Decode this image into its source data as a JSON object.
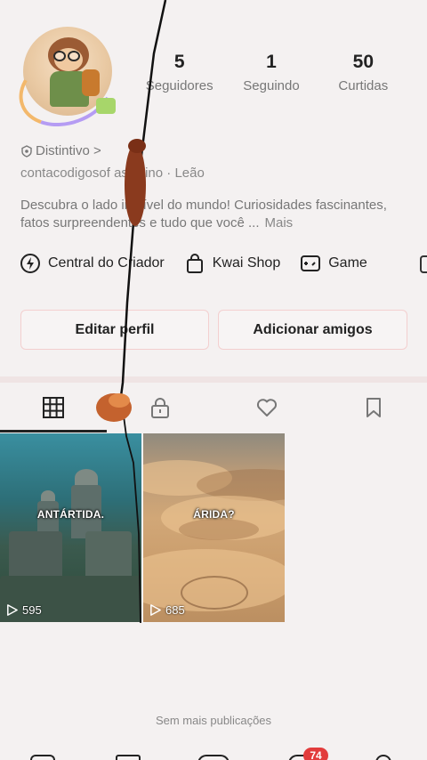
{
  "profile": {
    "stats": [
      {
        "value": "5",
        "label": "Seguidores"
      },
      {
        "value": "1",
        "label": "Seguindo"
      },
      {
        "value": "50",
        "label": "Curtidas"
      }
    ],
    "badge": "Distintivo >",
    "info_line": "contacodigosof      asculino · Leão",
    "bio": "Descubra o lado incrível do mundo! Curiosidades fascinantes, fatos surpreendentes e tudo que você ...",
    "bio_more": "Mais"
  },
  "tools": [
    {
      "label": "Central do Criador",
      "icon": "lightning-icon"
    },
    {
      "label": "Kwai Shop",
      "icon": "shopping-bag-icon"
    },
    {
      "label": "Game",
      "icon": "gamepad-icon"
    }
  ],
  "buttons": {
    "edit": "Editar perfil",
    "add": "Adicionar amigos"
  },
  "tabs": [
    {
      "name": "grid",
      "icon": "grid-icon",
      "active": true
    },
    {
      "name": "private",
      "icon": "lock-icon",
      "active": false
    },
    {
      "name": "liked",
      "icon": "heart-icon",
      "active": false
    },
    {
      "name": "saved",
      "icon": "bookmark-icon",
      "active": false
    }
  ],
  "posts": [
    {
      "caption": "ANTÁRTIDA.",
      "views": "595"
    },
    {
      "caption": "ÁRIDA?",
      "views": "685"
    }
  ],
  "end_note": "Sem mais publicações",
  "navbar": {
    "notification_count": "74"
  },
  "colors": {
    "background": "#f4f1f1",
    "badge_red": "#e23c3c",
    "button_border": "#f3cfcf"
  }
}
